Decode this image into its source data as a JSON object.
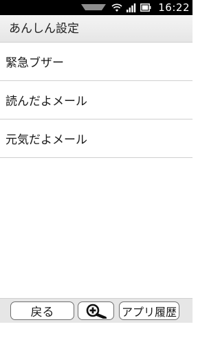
{
  "status_bar": {
    "time": "16:22",
    "icons": [
      "wifi-icon",
      "signal-icon",
      "battery-icon"
    ]
  },
  "header": {
    "title": "あんしん設定"
  },
  "list": {
    "items": [
      {
        "label": "緊急ブザー"
      },
      {
        "label": "読んだよメール"
      },
      {
        "label": "元気だよメール"
      }
    ]
  },
  "bottom_bar": {
    "back_label": "戻る",
    "zoom_icon": "zoom-in-icon",
    "history_label": "アプリ履歴"
  }
}
